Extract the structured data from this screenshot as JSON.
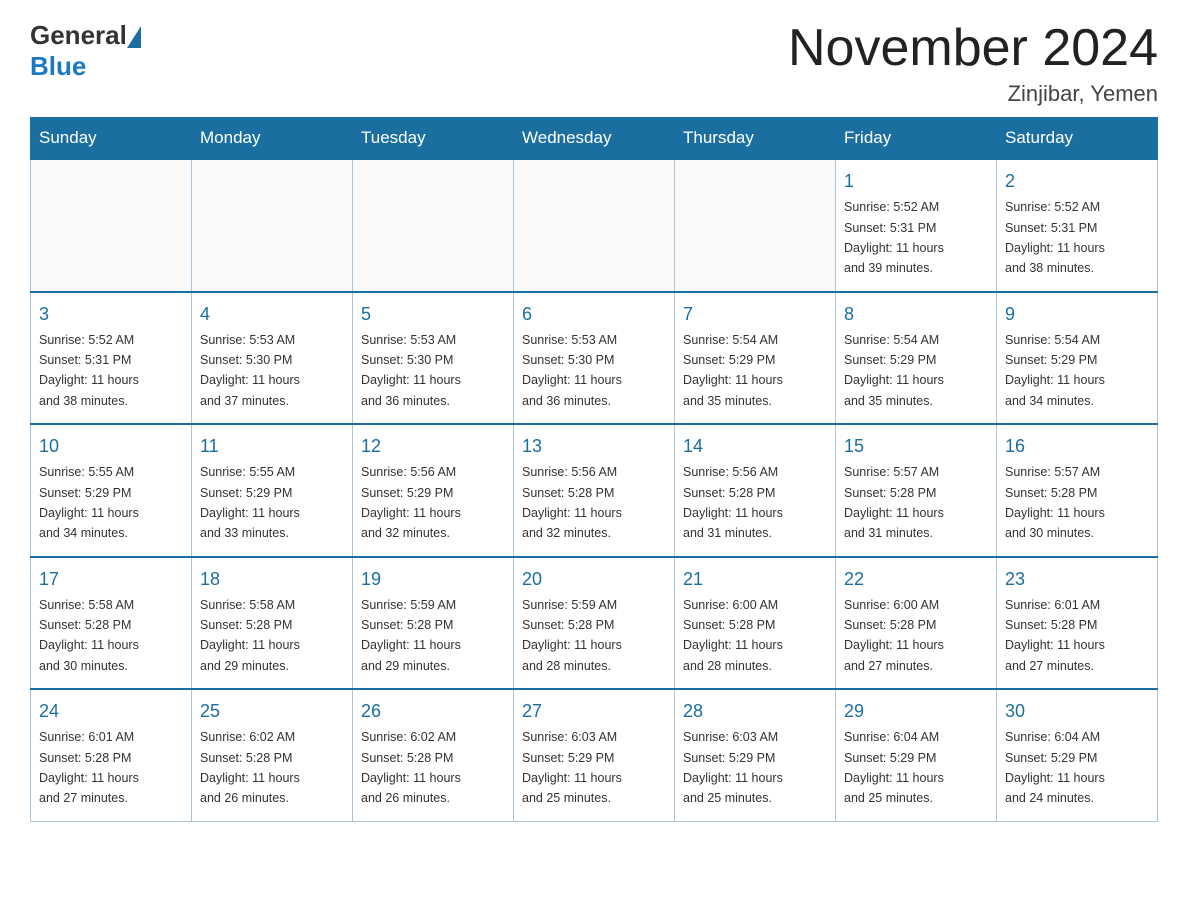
{
  "header": {
    "title": "November 2024",
    "subtitle": "Zinjibar, Yemen",
    "logo_general": "General",
    "logo_blue": "Blue"
  },
  "days_of_week": [
    "Sunday",
    "Monday",
    "Tuesday",
    "Wednesday",
    "Thursday",
    "Friday",
    "Saturday"
  ],
  "weeks": [
    [
      {
        "day": "",
        "info": ""
      },
      {
        "day": "",
        "info": ""
      },
      {
        "day": "",
        "info": ""
      },
      {
        "day": "",
        "info": ""
      },
      {
        "day": "",
        "info": ""
      },
      {
        "day": "1",
        "info": "Sunrise: 5:52 AM\nSunset: 5:31 PM\nDaylight: 11 hours\nand 39 minutes."
      },
      {
        "day": "2",
        "info": "Sunrise: 5:52 AM\nSunset: 5:31 PM\nDaylight: 11 hours\nand 38 minutes."
      }
    ],
    [
      {
        "day": "3",
        "info": "Sunrise: 5:52 AM\nSunset: 5:31 PM\nDaylight: 11 hours\nand 38 minutes."
      },
      {
        "day": "4",
        "info": "Sunrise: 5:53 AM\nSunset: 5:30 PM\nDaylight: 11 hours\nand 37 minutes."
      },
      {
        "day": "5",
        "info": "Sunrise: 5:53 AM\nSunset: 5:30 PM\nDaylight: 11 hours\nand 36 minutes."
      },
      {
        "day": "6",
        "info": "Sunrise: 5:53 AM\nSunset: 5:30 PM\nDaylight: 11 hours\nand 36 minutes."
      },
      {
        "day": "7",
        "info": "Sunrise: 5:54 AM\nSunset: 5:29 PM\nDaylight: 11 hours\nand 35 minutes."
      },
      {
        "day": "8",
        "info": "Sunrise: 5:54 AM\nSunset: 5:29 PM\nDaylight: 11 hours\nand 35 minutes."
      },
      {
        "day": "9",
        "info": "Sunrise: 5:54 AM\nSunset: 5:29 PM\nDaylight: 11 hours\nand 34 minutes."
      }
    ],
    [
      {
        "day": "10",
        "info": "Sunrise: 5:55 AM\nSunset: 5:29 PM\nDaylight: 11 hours\nand 34 minutes."
      },
      {
        "day": "11",
        "info": "Sunrise: 5:55 AM\nSunset: 5:29 PM\nDaylight: 11 hours\nand 33 minutes."
      },
      {
        "day": "12",
        "info": "Sunrise: 5:56 AM\nSunset: 5:29 PM\nDaylight: 11 hours\nand 32 minutes."
      },
      {
        "day": "13",
        "info": "Sunrise: 5:56 AM\nSunset: 5:28 PM\nDaylight: 11 hours\nand 32 minutes."
      },
      {
        "day": "14",
        "info": "Sunrise: 5:56 AM\nSunset: 5:28 PM\nDaylight: 11 hours\nand 31 minutes."
      },
      {
        "day": "15",
        "info": "Sunrise: 5:57 AM\nSunset: 5:28 PM\nDaylight: 11 hours\nand 31 minutes."
      },
      {
        "day": "16",
        "info": "Sunrise: 5:57 AM\nSunset: 5:28 PM\nDaylight: 11 hours\nand 30 minutes."
      }
    ],
    [
      {
        "day": "17",
        "info": "Sunrise: 5:58 AM\nSunset: 5:28 PM\nDaylight: 11 hours\nand 30 minutes."
      },
      {
        "day": "18",
        "info": "Sunrise: 5:58 AM\nSunset: 5:28 PM\nDaylight: 11 hours\nand 29 minutes."
      },
      {
        "day": "19",
        "info": "Sunrise: 5:59 AM\nSunset: 5:28 PM\nDaylight: 11 hours\nand 29 minutes."
      },
      {
        "day": "20",
        "info": "Sunrise: 5:59 AM\nSunset: 5:28 PM\nDaylight: 11 hours\nand 28 minutes."
      },
      {
        "day": "21",
        "info": "Sunrise: 6:00 AM\nSunset: 5:28 PM\nDaylight: 11 hours\nand 28 minutes."
      },
      {
        "day": "22",
        "info": "Sunrise: 6:00 AM\nSunset: 5:28 PM\nDaylight: 11 hours\nand 27 minutes."
      },
      {
        "day": "23",
        "info": "Sunrise: 6:01 AM\nSunset: 5:28 PM\nDaylight: 11 hours\nand 27 minutes."
      }
    ],
    [
      {
        "day": "24",
        "info": "Sunrise: 6:01 AM\nSunset: 5:28 PM\nDaylight: 11 hours\nand 27 minutes."
      },
      {
        "day": "25",
        "info": "Sunrise: 6:02 AM\nSunset: 5:28 PM\nDaylight: 11 hours\nand 26 minutes."
      },
      {
        "day": "26",
        "info": "Sunrise: 6:02 AM\nSunset: 5:28 PM\nDaylight: 11 hours\nand 26 minutes."
      },
      {
        "day": "27",
        "info": "Sunrise: 6:03 AM\nSunset: 5:29 PM\nDaylight: 11 hours\nand 25 minutes."
      },
      {
        "day": "28",
        "info": "Sunrise: 6:03 AM\nSunset: 5:29 PM\nDaylight: 11 hours\nand 25 minutes."
      },
      {
        "day": "29",
        "info": "Sunrise: 6:04 AM\nSunset: 5:29 PM\nDaylight: 11 hours\nand 25 minutes."
      },
      {
        "day": "30",
        "info": "Sunrise: 6:04 AM\nSunset: 5:29 PM\nDaylight: 11 hours\nand 24 minutes."
      }
    ]
  ]
}
